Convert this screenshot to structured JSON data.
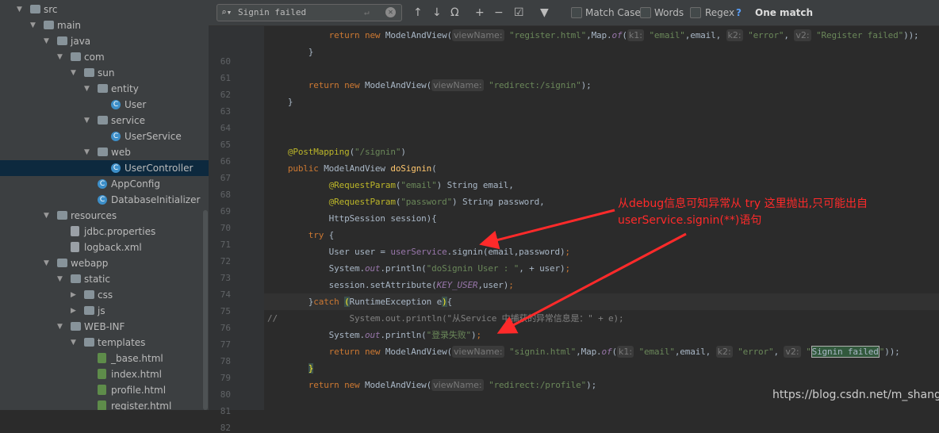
{
  "tree": [
    {
      "label": "src",
      "depth": 0,
      "icon": "folder",
      "expanded": true
    },
    {
      "label": "main",
      "depth": 1,
      "icon": "folder",
      "expanded": true
    },
    {
      "label": "java",
      "depth": 2,
      "icon": "folder",
      "expanded": true
    },
    {
      "label": "com",
      "depth": 3,
      "icon": "folder",
      "expanded": true
    },
    {
      "label": "sun",
      "depth": 4,
      "icon": "folder",
      "expanded": true
    },
    {
      "label": "entity",
      "depth": 5,
      "icon": "folder",
      "expanded": true
    },
    {
      "label": "User",
      "depth": 6,
      "icon": "class"
    },
    {
      "label": "service",
      "depth": 5,
      "icon": "folder",
      "expanded": true
    },
    {
      "label": "UserService",
      "depth": 6,
      "icon": "class"
    },
    {
      "label": "web",
      "depth": 5,
      "icon": "folder",
      "expanded": true
    },
    {
      "label": "UserController",
      "depth": 6,
      "icon": "class",
      "selected": true
    },
    {
      "label": "AppConfig",
      "depth": 5,
      "icon": "class"
    },
    {
      "label": "DatabaseInitializer",
      "depth": 5,
      "icon": "class"
    },
    {
      "label": "resources",
      "depth": 2,
      "icon": "folder",
      "expanded": true
    },
    {
      "label": "jdbc.properties",
      "depth": 3,
      "icon": "file"
    },
    {
      "label": "logback.xml",
      "depth": 3,
      "icon": "file"
    },
    {
      "label": "webapp",
      "depth": 2,
      "icon": "folder",
      "expanded": true
    },
    {
      "label": "static",
      "depth": 3,
      "icon": "folder",
      "expanded": true
    },
    {
      "label": "css",
      "depth": 4,
      "icon": "folder",
      "expanded": false
    },
    {
      "label": "js",
      "depth": 4,
      "icon": "folder",
      "expanded": false
    },
    {
      "label": "WEB-INF",
      "depth": 3,
      "icon": "folder",
      "expanded": true
    },
    {
      "label": "templates",
      "depth": 4,
      "icon": "folder",
      "expanded": true
    },
    {
      "label": "_base.html",
      "depth": 5,
      "icon": "html"
    },
    {
      "label": "index.html",
      "depth": 5,
      "icon": "html"
    },
    {
      "label": "profile.html",
      "depth": 5,
      "icon": "html"
    },
    {
      "label": "register.html",
      "depth": 5,
      "icon": "html"
    }
  ],
  "find": {
    "query": "Signin failed",
    "match_case": "Match Case",
    "words": "Words",
    "regex": "Regex",
    "help": "?",
    "status": "One match"
  },
  "code": [
    {
      "n": "60",
      "t": [
        [
          "",
          "            "
        ],
        [
          "kw",
          "return new "
        ],
        [
          "",
          "ModelAndView("
        ],
        [
          "hint",
          "viewName:"
        ],
        [
          "str",
          " \"register.html\""
        ],
        [
          "",
          ",Map."
        ],
        [
          "fld",
          "of"
        ],
        [
          "",
          "("
        ],
        [
          "hint",
          "k1:"
        ],
        [
          "str",
          " \"email\""
        ],
        [
          "",
          ",email, "
        ],
        [
          "hint",
          "k2:"
        ],
        [
          "str",
          " \"error\""
        ],
        [
          "",
          ", "
        ],
        [
          "hint",
          "v2:"
        ],
        [
          "str",
          " \"Register failed\""
        ],
        [
          "",
          "));"
        ]
      ]
    },
    {
      "n": "61",
      "t": [
        [
          "",
          "        }"
        ]
      ]
    },
    {
      "n": "62",
      "t": []
    },
    {
      "n": "63",
      "t": [
        [
          "",
          "        "
        ],
        [
          "kw",
          "return new "
        ],
        [
          "",
          "ModelAndView("
        ],
        [
          "hint",
          "viewName:"
        ],
        [
          "str",
          " \"redirect:/signin\""
        ],
        [
          "",
          ");"
        ]
      ]
    },
    {
      "n": "64",
      "t": [
        [
          "",
          "    }"
        ]
      ]
    },
    {
      "n": "65",
      "t": []
    },
    {
      "n": "66",
      "t": []
    },
    {
      "n": "67",
      "t": [
        [
          "ann",
          "    @PostMapping"
        ],
        [
          "",
          "("
        ],
        [
          "str",
          "\"/signin\""
        ],
        [
          "",
          ")"
        ]
      ]
    },
    {
      "n": "68",
      "t": [
        [
          "kw",
          "    public "
        ],
        [
          "",
          "ModelAndView "
        ],
        [
          "fn",
          "doSignin"
        ],
        [
          "",
          "("
        ]
      ]
    },
    {
      "n": "69",
      "t": [
        [
          "ann",
          "            @RequestParam"
        ],
        [
          "",
          "("
        ],
        [
          "str",
          "\"email\""
        ],
        [
          "",
          ") String email,"
        ]
      ]
    },
    {
      "n": "70",
      "t": [
        [
          "ann",
          "            @RequestParam"
        ],
        [
          "",
          "("
        ],
        [
          "str",
          "\"password\""
        ],
        [
          "",
          ") String password,"
        ]
      ]
    },
    {
      "n": "71",
      "t": [
        [
          "",
          "            HttpSession session){"
        ]
      ]
    },
    {
      "n": "72",
      "t": [
        [
          "kw",
          "        try "
        ],
        [
          "",
          "{"
        ]
      ]
    },
    {
      "n": "73",
      "t": [
        [
          "",
          "            User user = "
        ],
        [
          "mem",
          "userService"
        ],
        [
          "",
          ".signin(email,password)"
        ],
        [
          "kw",
          ";"
        ]
      ]
    },
    {
      "n": "74",
      "t": [
        [
          "",
          "            System."
        ],
        [
          "fld",
          "out"
        ],
        [
          "",
          ".println("
        ],
        [
          "str",
          "\"doSignin User : \""
        ],
        [
          "",
          ", + user)"
        ],
        [
          "kw",
          ";"
        ]
      ]
    },
    {
      "n": "75",
      "t": [
        [
          "",
          "            session.setAttribute("
        ],
        [
          "cst",
          "KEY_USER"
        ],
        [
          "",
          ",user)"
        ],
        [
          "kw",
          ";"
        ]
      ]
    },
    {
      "n": "76",
      "t": [
        [
          "",
          "        }"
        ],
        [
          "kw",
          "catch "
        ],
        [
          "brace",
          "("
        ],
        [
          "",
          "RuntimeException e"
        ],
        [
          "brace",
          ")"
        ],
        [
          "",
          "{"
        ]
      ],
      "current": true
    },
    {
      "n": "77",
      "t": [
        [
          "cm",
          "//              System.out.println(\"从Service 中捕获的异常信息是：\" + e);"
        ]
      ]
    },
    {
      "n": "78",
      "t": [
        [
          "",
          "            System."
        ],
        [
          "fld",
          "out"
        ],
        [
          "",
          ".println("
        ],
        [
          "str",
          "\"登录失败\""
        ],
        [
          "",
          ")"
        ],
        [
          "kw",
          ";"
        ]
      ]
    },
    {
      "n": "79",
      "t": [
        [
          "",
          "            "
        ],
        [
          "kw",
          "return new "
        ],
        [
          "",
          "ModelAndView("
        ],
        [
          "hint",
          "viewName:"
        ],
        [
          "str",
          " \"signin.html\""
        ],
        [
          "",
          ",Map."
        ],
        [
          "fld",
          "of"
        ],
        [
          "",
          "("
        ],
        [
          "hint",
          "k1:"
        ],
        [
          "str",
          " \"email\""
        ],
        [
          "",
          ",email, "
        ],
        [
          "hint",
          "k2:"
        ],
        [
          "str",
          " \"error\""
        ],
        [
          "",
          ", "
        ],
        [
          "hint",
          "v2:"
        ],
        [
          "str",
          " \""
        ],
        [
          "match",
          "Signin failed"
        ],
        [
          "str",
          "\""
        ],
        [
          "",
          "));"
        ]
      ]
    },
    {
      "n": "80",
      "t": [
        [
          "",
          "        "
        ],
        [
          "brace",
          "}"
        ]
      ]
    },
    {
      "n": "81",
      "t": [
        [
          "",
          "        "
        ],
        [
          "kw",
          "return new "
        ],
        [
          "",
          "ModelAndView("
        ],
        [
          "hint",
          "viewName:"
        ],
        [
          "str",
          " \"redirect:/profile\""
        ],
        [
          "",
          ");"
        ]
      ]
    },
    {
      "n": "82",
      "t": []
    }
  ],
  "annotation": "从debug信息可知异常从 try 这里抛出,只可能出自userService.signin(**)语句",
  "watermark": "https://blog.csdn.net/m_shang",
  "colors": {
    "annotation": "#ff2a2a",
    "selection": "#0d293e",
    "match": "#32593d"
  }
}
